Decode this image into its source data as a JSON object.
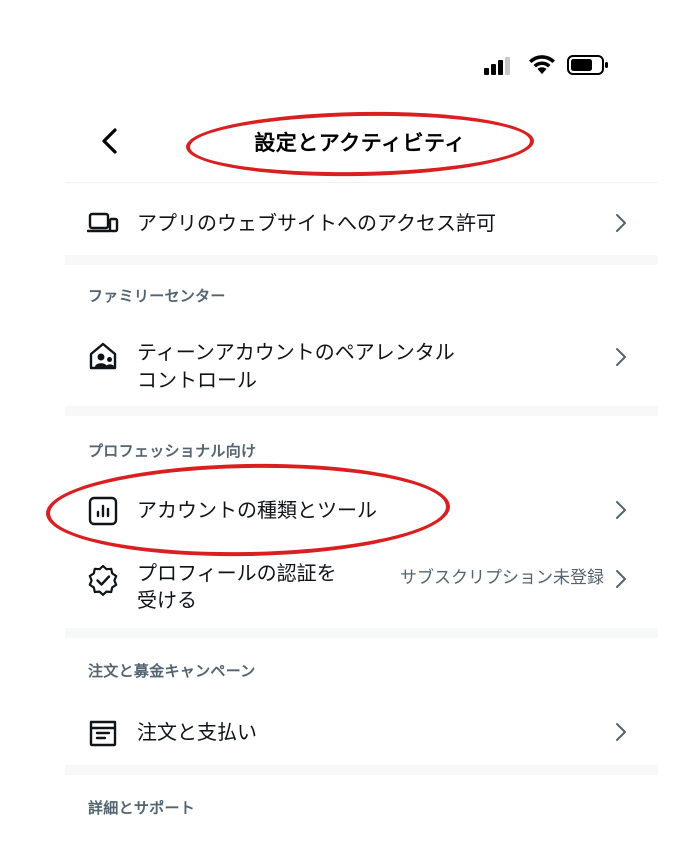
{
  "nav": {
    "title": "設定とアクティビティ"
  },
  "rows": {
    "app_access": "アプリのウェブサイトへのアクセス許可",
    "teen_control_line1": "ティーンアカウントのペアレンタル",
    "teen_control_line2": "コントロール",
    "account_type": "アカウントの種類とツール",
    "profile_verify_line1": "プロフィールの認証を",
    "profile_verify_line2": "受ける",
    "profile_verify_value": "サブスクリプション未登録",
    "orders": "注文と支払い"
  },
  "sections": {
    "family_center": "ファミリーセンター",
    "professional": "プロフェッショナル向け",
    "orders_fundraising": "注文と募金キャンペーン",
    "details_support": "詳細とサポート"
  },
  "colors": {
    "annotation": "#d91f1f",
    "text_primary": "#0f1419",
    "text_secondary": "#536471"
  }
}
